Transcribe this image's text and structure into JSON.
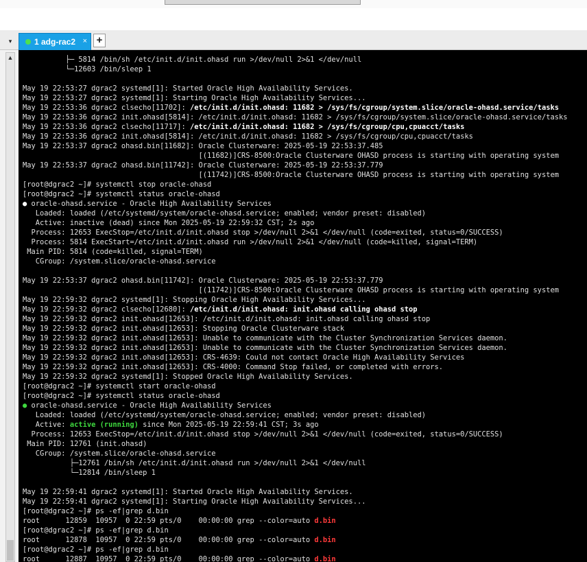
{
  "app": {
    "tab_title": "1 adg-rac2",
    "tab_close": "×",
    "new_tab": "+",
    "tab_menu": "▾",
    "scroll_up": "▲"
  },
  "colors": {
    "terminal_bg": "#000000",
    "terminal_fg": "#e0e0e0",
    "tab_bg": "#1aa1e6",
    "status_dot_connected": "#4fe04f",
    "active_green": "#3ed83e",
    "grep_match_red": "#ff3a3a"
  },
  "icons": {
    "tab_status": "green-dot-icon",
    "tab_close": "close-icon",
    "new_tab": "plus-icon",
    "tab_menu": "chevron-down-icon",
    "scroll_up": "arrow-up-icon"
  },
  "terminal": {
    "lines": [
      [
        {
          "t": "          ├─ 5814 /bin/sh /etc/init.d/init.ohasd run >/dev/null 2>&1 </dev/null"
        }
      ],
      [
        {
          "t": "          └─12603 /bin/sleep 1"
        }
      ],
      [
        {
          "t": ""
        }
      ],
      [
        {
          "t": "May 19 22:53:27 dgrac2 systemd[1]: Started Oracle High Availability Services."
        }
      ],
      [
        {
          "t": "May 19 22:53:27 dgrac2 systemd[1]: Starting Oracle High Availability Services..."
        }
      ],
      [
        {
          "t": "May 19 22:53:36 dgrac2 clsecho[11702]: "
        },
        {
          "t": "/etc/init.d/init.ohasd: 11682 > /sys/fs/cgroup/system.slice/oracle-ohasd.service/tasks",
          "c": "b"
        }
      ],
      [
        {
          "t": "May 19 22:53:36 dgrac2 init.ohasd[5814]: /etc/init.d/init.ohasd: 11682 > /sys/fs/cgroup/system.slice/oracle-ohasd.service/tasks"
        }
      ],
      [
        {
          "t": "May 19 22:53:36 dgrac2 clsecho[11717]: "
        },
        {
          "t": "/etc/init.d/init.ohasd: 11682 > /sys/fs/cgroup/cpu,cpuacct/tasks",
          "c": "b"
        }
      ],
      [
        {
          "t": "May 19 22:53:36 dgrac2 init.ohasd[5814]: /etc/init.d/init.ohasd: 11682 > /sys/fs/cgroup/cpu,cpuacct/tasks"
        }
      ],
      [
        {
          "t": "May 19 22:53:37 dgrac2 ohasd.bin[11682]: Oracle Clusterware: 2025-05-19 22:53:37.485"
        }
      ],
      [
        {
          "t": "                                         [(11682)]CRS-8500:Oracle Clusterware OHASD process is starting with operating system"
        }
      ],
      [
        {
          "t": "May 19 22:53:37 dgrac2 ohasd.bin[11742]: Oracle Clusterware: 2025-05-19 22:53:37.779"
        }
      ],
      [
        {
          "t": "                                         [(11742)]CRS-8500:Oracle Clusterware OHASD process is starting with operating system"
        }
      ],
      [
        {
          "t": "[root@dgrac2 ~]# systemctl stop oracle-ohasd"
        }
      ],
      [
        {
          "t": "[root@dgrac2 ~]# systemctl status oracle-ohasd"
        }
      ],
      [
        {
          "t": "●",
          "c": "w"
        },
        {
          "t": " oracle-ohasd.service - Oracle High Availability Services"
        }
      ],
      [
        {
          "t": "   Loaded: loaded (/etc/systemd/system/oracle-ohasd.service; enabled; vendor preset: disabled)"
        }
      ],
      [
        {
          "t": "   Active: inactive (dead) since Mon 2025-05-19 22:59:32 CST; 2s ago"
        }
      ],
      [
        {
          "t": "  Process: 12653 ExecStop=/etc/init.d/init.ohasd stop >/dev/null 2>&1 </dev/null (code=exited, status=0/SUCCESS)"
        }
      ],
      [
        {
          "t": "  Process: 5814 ExecStart=/etc/init.d/init.ohasd run >/dev/null 2>&1 </dev/null (code=killed, signal=TERM)"
        }
      ],
      [
        {
          "t": " Main PID: 5814 (code=killed, signal=TERM)"
        }
      ],
      [
        {
          "t": "   CGroup: /system.slice/oracle-ohasd.service"
        }
      ],
      [
        {
          "t": ""
        }
      ],
      [
        {
          "t": "May 19 22:53:37 dgrac2 ohasd.bin[11742]: Oracle Clusterware: 2025-05-19 22:53:37.779"
        }
      ],
      [
        {
          "t": "                                         [(11742)]CRS-8500:Oracle Clusterware OHASD process is starting with operating system"
        }
      ],
      [
        {
          "t": "May 19 22:59:32 dgrac2 systemd[1]: Stopping Oracle High Availability Services..."
        }
      ],
      [
        {
          "t": "May 19 22:59:32 dgrac2 clsecho[12680]: "
        },
        {
          "t": "/etc/init.d/init.ohasd: init.ohasd calling ohasd stop",
          "c": "b"
        }
      ],
      [
        {
          "t": "May 19 22:59:32 dgrac2 init.ohasd[12653]: /etc/init.d/init.ohasd: init.ohasd calling ohasd stop"
        }
      ],
      [
        {
          "t": "May 19 22:59:32 dgrac2 init.ohasd[12653]: Stopping Oracle Clusterware stack"
        }
      ],
      [
        {
          "t": "May 19 22:59:32 dgrac2 init.ohasd[12653]: Unable to communicate with the Cluster Synchronization Services daemon."
        }
      ],
      [
        {
          "t": "May 19 22:59:32 dgrac2 init.ohasd[12653]: Unable to communicate with the Cluster Synchronization Services daemon."
        }
      ],
      [
        {
          "t": "May 19 22:59:32 dgrac2 init.ohasd[12653]: CRS-4639: Could not contact Oracle High Availability Services"
        }
      ],
      [
        {
          "t": "May 19 22:59:32 dgrac2 init.ohasd[12653]: CRS-4000: Command Stop failed, or completed with errors."
        }
      ],
      [
        {
          "t": "May 19 22:59:32 dgrac2 systemd[1]: Stopped Oracle High Availability Services."
        }
      ],
      [
        {
          "t": "[root@dgrac2 ~]# systemctl start oracle-ohasd"
        }
      ],
      [
        {
          "t": "[root@dgrac2 ~]# systemctl status oracle-ohasd"
        }
      ],
      [
        {
          "t": "●",
          "c": "g"
        },
        {
          "t": " oracle-ohasd.service - Oracle High Availability Services"
        }
      ],
      [
        {
          "t": "   Loaded: loaded (/etc/systemd/system/oracle-ohasd.service; enabled; vendor preset: disabled)"
        }
      ],
      [
        {
          "t": "   Active: "
        },
        {
          "t": "active (running)",
          "c": "g"
        },
        {
          "t": " since Mon 2025-05-19 22:59:41 CST; 3s ago"
        }
      ],
      [
        {
          "t": "  Process: 12653 ExecStop=/etc/init.d/init.ohasd stop >/dev/null 2>&1 </dev/null (code=exited, status=0/SUCCESS)"
        }
      ],
      [
        {
          "t": " Main PID: 12761 (init.ohasd)"
        }
      ],
      [
        {
          "t": "   CGroup: /system.slice/oracle-ohasd.service"
        }
      ],
      [
        {
          "t": "           ├─12761 /bin/sh /etc/init.d/init.ohasd run >/dev/null 2>&1 </dev/null"
        }
      ],
      [
        {
          "t": "           └─12814 /bin/sleep 1"
        }
      ],
      [
        {
          "t": ""
        }
      ],
      [
        {
          "t": "May 19 22:59:41 dgrac2 systemd[1]: Started Oracle High Availability Services."
        }
      ],
      [
        {
          "t": "May 19 22:59:41 dgrac2 systemd[1]: Starting Oracle High Availability Services..."
        }
      ],
      [
        {
          "t": "[root@dgrac2 ~]# ps -ef|grep d.bin"
        }
      ],
      [
        {
          "t": "root      12859  10957  0 22:59 pts/0    00:00:00 grep --color=auto "
        },
        {
          "t": "d.bin",
          "c": "r"
        }
      ],
      [
        {
          "t": "[root@dgrac2 ~]# ps -ef|grep d.bin"
        }
      ],
      [
        {
          "t": "root      12878  10957  0 22:59 pts/0    00:00:00 grep --color=auto "
        },
        {
          "t": "d.bin",
          "c": "r"
        }
      ],
      [
        {
          "t": "[root@dgrac2 ~]# ps -ef|grep d.bin"
        }
      ],
      [
        {
          "t": "root      12887  10957  0 22:59 pts/0    00:00:00 grep --color=auto "
        },
        {
          "t": "d.bin",
          "c": "r"
        }
      ]
    ]
  }
}
